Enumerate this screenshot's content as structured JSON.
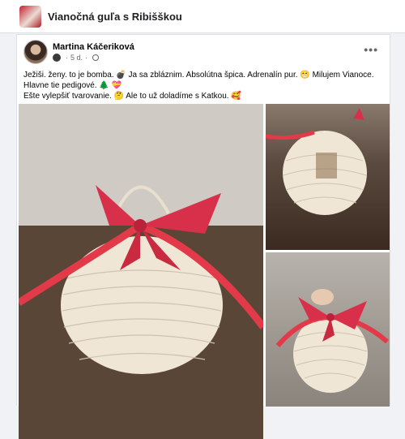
{
  "group": {
    "title": "Vianočná guľa s Ribišškou"
  },
  "post": {
    "author": "Martina Káčeriková",
    "time": "5 d.",
    "text_lines": [
      "Ježiši. ženy. to je bomba. 💣 Ja sa zbláznim. Absolútna špica. Adrenalín pur. 😁 Milujem Vianoce.",
      "Hlavne tie pedigové. 🌲 💝",
      "Ešte vylepšiť tvarovanie. 🤔 Ale to už doladíme s Katkou. 🥰"
    ],
    "more_label": "•••"
  },
  "photos": [
    "ornament-photo-main",
    "ornament-photo-top",
    "ornament-photo-bottom"
  ]
}
